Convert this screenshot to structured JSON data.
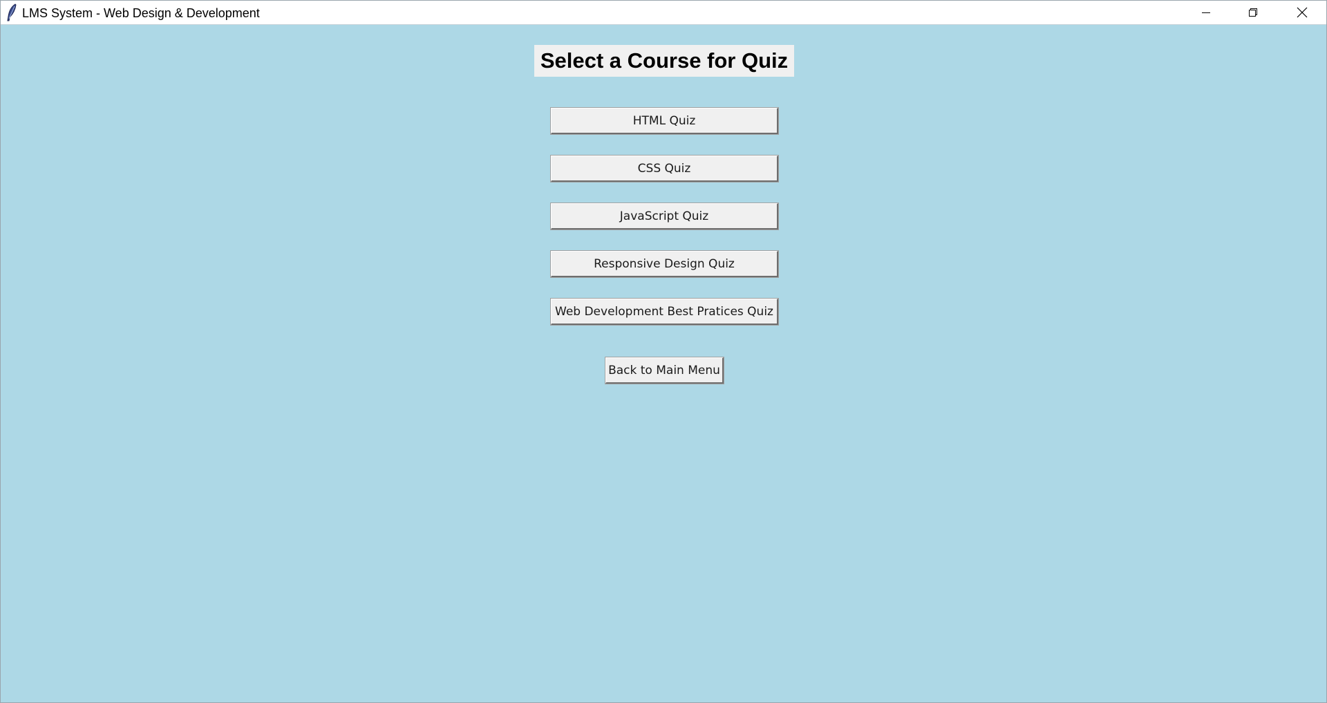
{
  "window": {
    "title": "LMS System - Web Design & Development",
    "background_color": "#add8e6",
    "controls": {
      "minimize_icon": "minimize-icon",
      "restore_icon": "restore-icon",
      "close_icon": "close-icon"
    }
  },
  "main": {
    "heading": "Select a Course for Quiz",
    "quiz_buttons": [
      {
        "label": "HTML Quiz"
      },
      {
        "label": "CSS Quiz"
      },
      {
        "label": "JavaScript Quiz"
      },
      {
        "label": "Responsive Design Quiz"
      },
      {
        "label": "Web Development Best Pratices Quiz"
      }
    ],
    "back_button": "Back to Main Menu"
  }
}
